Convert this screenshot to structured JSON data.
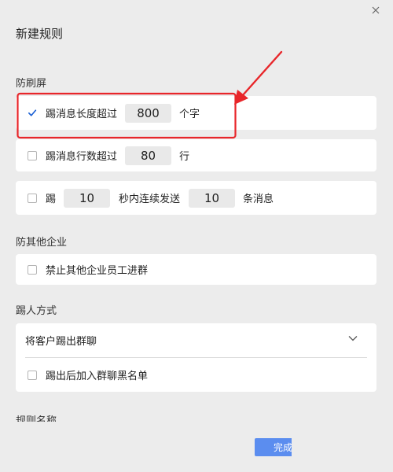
{
  "dialog": {
    "title": "新建规则",
    "close_symbol": "×"
  },
  "anti_spam": {
    "section_label": "防刷屏",
    "message_length": {
      "checked": true,
      "label": "踢消息长度超过",
      "value": "800",
      "unit": "个字"
    },
    "message_lines": {
      "checked": false,
      "label": "踢消息行数超过",
      "value": "80",
      "unit": "行"
    },
    "consecutive": {
      "checked": false,
      "label_prefix": "踢",
      "seconds": "10",
      "label_middle": "秒内连续发送",
      "count": "10",
      "label_suffix": "条消息"
    }
  },
  "anti_other_company": {
    "section_label": "防其他企业",
    "ban_other_company": {
      "checked": false,
      "label": "禁止其他企业员工进群"
    }
  },
  "kick_method": {
    "section_label": "踢人方式",
    "selected_option": "将客户踢出群聊",
    "blacklist": {
      "checked": false,
      "label": "踢出后加入群聊黑名单"
    }
  },
  "rule_name": {
    "section_label": "规则名称"
  },
  "footer": {
    "done_label": "完成"
  },
  "colors": {
    "accent": "#5b8def",
    "checkbox_checked": "#1a5fd4",
    "annotation": "#e8262a",
    "background": "#ececec",
    "card": "#ffffff"
  },
  "icons": {
    "close": "close-icon",
    "check": "check-icon",
    "chevron": "chevron-down-icon",
    "annotation_arrow": "arrow-icon"
  }
}
